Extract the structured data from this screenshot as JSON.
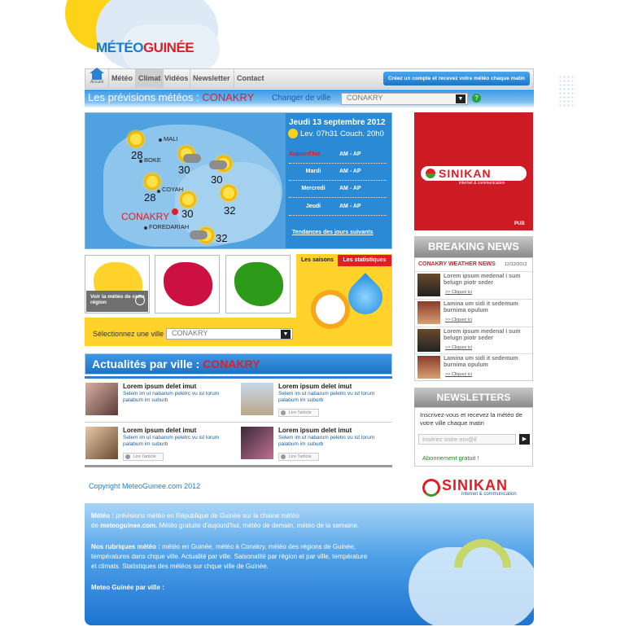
{
  "logo": {
    "part1": "MÉTÉO",
    "part2": "GUINÉE"
  },
  "nav": {
    "home_label": "Accueil",
    "items": [
      "Météo",
      "Climat",
      "Vidéos",
      "Newsletter",
      "Contact"
    ],
    "active": "Climat",
    "cta": "Créez un compte et recevez votre météo chaque matin"
  },
  "forecast_bar": {
    "title": "Les prévisions météos : ",
    "city": "CONAKRY",
    "change_label": "Changer de ville",
    "select_value": "CONAKRY"
  },
  "map": {
    "cities": [
      {
        "name": "MALI"
      },
      {
        "name": "BOKE"
      },
      {
        "name": "COYAH"
      },
      {
        "name": "FOREDARIAH"
      }
    ],
    "capital": "CONAKRY",
    "temps": [
      "28",
      "30",
      "30",
      "28",
      "32",
      "30",
      "32"
    ],
    "info": {
      "date": "Jeudi 13 septembre 2012",
      "sun": "Lev. 07h31 Couch. 20h0",
      "rows": [
        {
          "day": "Aujourd'hui",
          "value": "AM - AP"
        },
        {
          "day": "Mardi",
          "value": "AM - AP"
        },
        {
          "day": "Mercredi",
          "value": "AM - AP"
        },
        {
          "day": "Jeudi",
          "value": "AM - AP"
        }
      ],
      "link": "Tendances des jours suivants"
    }
  },
  "regions": {
    "button": "Voir la météo de cette région",
    "colors": [
      "#ffd32b",
      "#cc1142",
      "#2e9a1a"
    ]
  },
  "stats": {
    "tab_seasons": "Les saisons",
    "tab_stats": "Les statistiques"
  },
  "city_select": {
    "label": "Sélectionnez une ville :",
    "value": "CONAKRY"
  },
  "actualites": {
    "title": "Actualités par ville : ",
    "city": "CONAKRY",
    "items": [
      {
        "title": "Lorem ipsum delet imut",
        "text": "Selem im ut nabarum peletrc vu ist lorum palabum im suburb",
        "button": "Lire l'article"
      },
      {
        "title": "Lorem ipsum delet imut",
        "text": "Selem im ut nabarum peletrc vu ist lorum palabum im suburb",
        "button": "Lire l'article"
      },
      {
        "title": "Lorem ipsum delet imut",
        "text": "Selem im ut nabarum peletrc vu ist lorum palabum im suburb",
        "button": "Lire l'article"
      },
      {
        "title": "Lorem ipsum delet imut",
        "text": "Selem im ut nabarum peletrc vu ist lorum palabum im suburb",
        "button": "Lire l'article"
      }
    ]
  },
  "ad": {
    "brand": "SINIKAN",
    "tagline": "internet & communication",
    "pub": "PUB"
  },
  "breaking": {
    "title": "BREAKING NEWS",
    "subtitle": "CONAKRY WEATHER NEWS",
    "date": "12/12/2012",
    "items": [
      {
        "title": "Lorem ipsum medenal i sum belugn piotr seder",
        "link": ">> Cliquez ici"
      },
      {
        "title": "Lamina um sidi it sedemum burnima opulum",
        "link": ">> Cliquez ici"
      },
      {
        "title": "Lorem ipsum medenal i sum belugn piotr seder",
        "link": ">> Cliquez ici"
      },
      {
        "title": "Lamina um sidi it sedemum burnima opulum",
        "link": ">> Cliquez ici"
      }
    ]
  },
  "newsletter": {
    "title": "NEWSLETTERS",
    "text": "Inscrivez-vous et recevez la météo de votre ville chaque matin",
    "placeholder": "Insérez votre em@il",
    "free": "Abonnement gratuit !"
  },
  "footer": {
    "copyright": "Copyright MeteoGuinee.com 2012",
    "brand": "SINIKAN",
    "brand_tagline": "internet & communication",
    "p1_bold": "Météo :",
    "p1_a": " prévisions météo en République de Guinée sur la chaine météo",
    "p1_b": "de ",
    "p1_site": "meteoguinee.com.",
    "p1_c": " Météo gratuite d'aujourd'hui, météo de demain, météo de la semaine.",
    "p2_bold": "Nos rubriques météo :",
    "p2_a": " météo en Guinée, météo à Conakry, météo des régions de Guinée,",
    "p2_b": "températures dans chque ville. Actualité par ville. Saisonalité par région et par ville, température",
    "p2_c": "et climats. Statistiques des météos sur chque ville de Guinée.",
    "p3_bold": "Meteo Guinée par ville :"
  }
}
